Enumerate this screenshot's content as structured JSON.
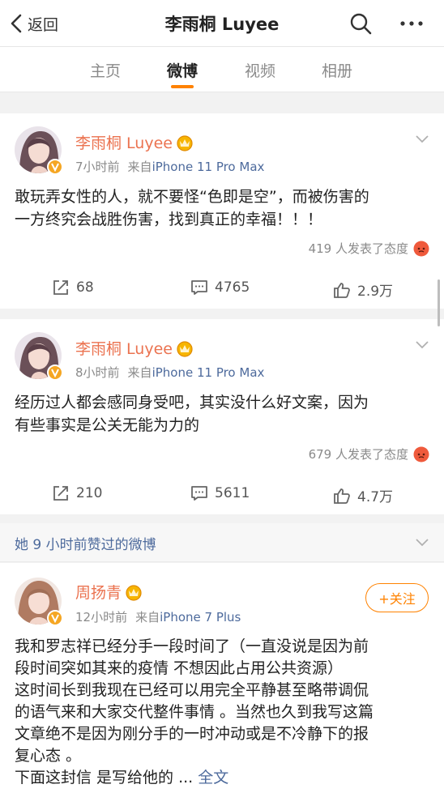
{
  "nav": {
    "back_label": "返回",
    "title": "李雨桐 Luyee",
    "icons": [
      "chevron-left-icon",
      "search-icon",
      "more-icon"
    ]
  },
  "tabs": [
    {
      "label": "主页",
      "active": false
    },
    {
      "label": "微博",
      "active": true
    },
    {
      "label": "视频",
      "active": false
    },
    {
      "label": "相册",
      "active": false
    }
  ],
  "posts": [
    {
      "username": "李雨桐 Luyee",
      "time": "7小时前",
      "source_prefix": "来自",
      "source": "iPhone 11 Pro Max",
      "lines": [
        "敢玩弄女性的人，就不要怪“色即是空”，而被伤害的",
        "一方终究会战胜伤害，找到真正的幸福！！！"
      ],
      "reaction_text": "419 人发表了态度",
      "reposts": "68",
      "comments": "4765",
      "likes": "2.9万"
    },
    {
      "username": "李雨桐 Luyee",
      "time": "8小时前",
      "source_prefix": "来自",
      "source": "iPhone 11 Pro Max",
      "lines": [
        "经历过人都会感同身受吧，其实没什么好文案，因为",
        "有些事实是公关无能为力的"
      ],
      "reaction_text": "679 人发表了态度",
      "reposts": "210",
      "comments": "5611",
      "likes": "4.7万"
    }
  ],
  "liked_section": {
    "label": "她 9 小时前赞过的微博"
  },
  "liked_post": {
    "username": "周扬青",
    "time": "12小时前",
    "source_prefix": "来自",
    "source": "iPhone 7 Plus",
    "follow_label": "+关注",
    "lines": [
      "我和罗志祥已经分手一段时间了（一直没说是因为前",
      "段时间突如其来的疫情 不想因此占用公共资源）",
      "这时间长到我现在已经可以用完全平静甚至略带调侃",
      "的语气来和大家交代整件事情 。当然也久到我写这篇",
      "文章绝不是因为刚分手的一时冲动或是不冷静下的报",
      "复心态 。"
    ],
    "last_line": "下面这封信 是写给他的 ...",
    "full_text_label": "全文"
  },
  "colors": {
    "accent": "#ff8200",
    "username": "#eb7350",
    "link": "#4d6a9c"
  }
}
